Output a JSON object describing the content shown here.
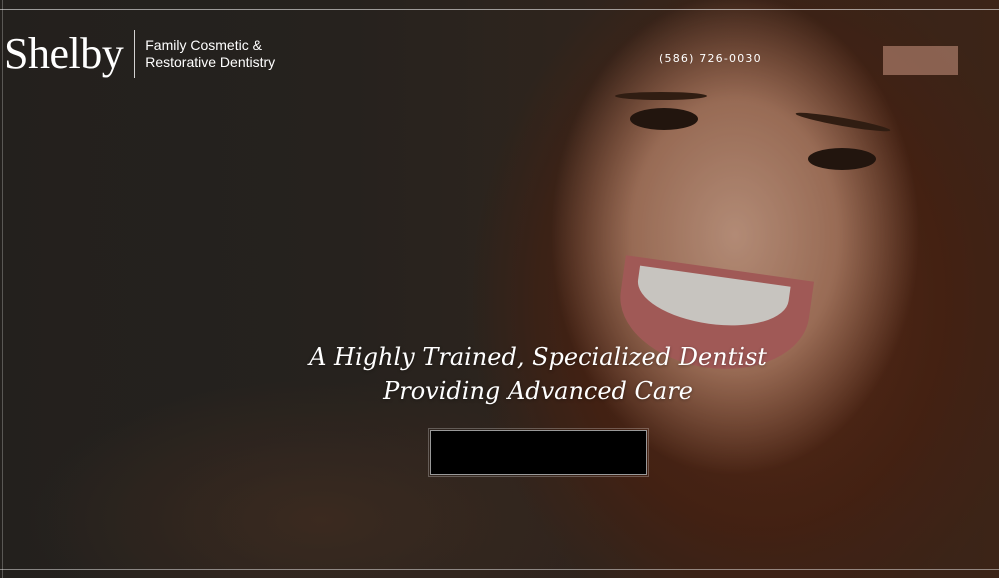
{
  "header": {
    "logo_word": "Shelby",
    "logo_tagline": "Family Cosmetic &\nRestorative Dentistry",
    "phone": "(586) 726-0030",
    "action_button_label": ""
  },
  "hero": {
    "headline_line1": "A Highly Trained, Specialized Dentist",
    "headline_line2": "Providing Advanced Care",
    "cta_label": "",
    "image_subject": "smiling-woman-photo"
  },
  "colors": {
    "overlay": "#1a1613",
    "text": "#ffffff",
    "header_button": "#cb9682",
    "cta_background": "#000000"
  }
}
